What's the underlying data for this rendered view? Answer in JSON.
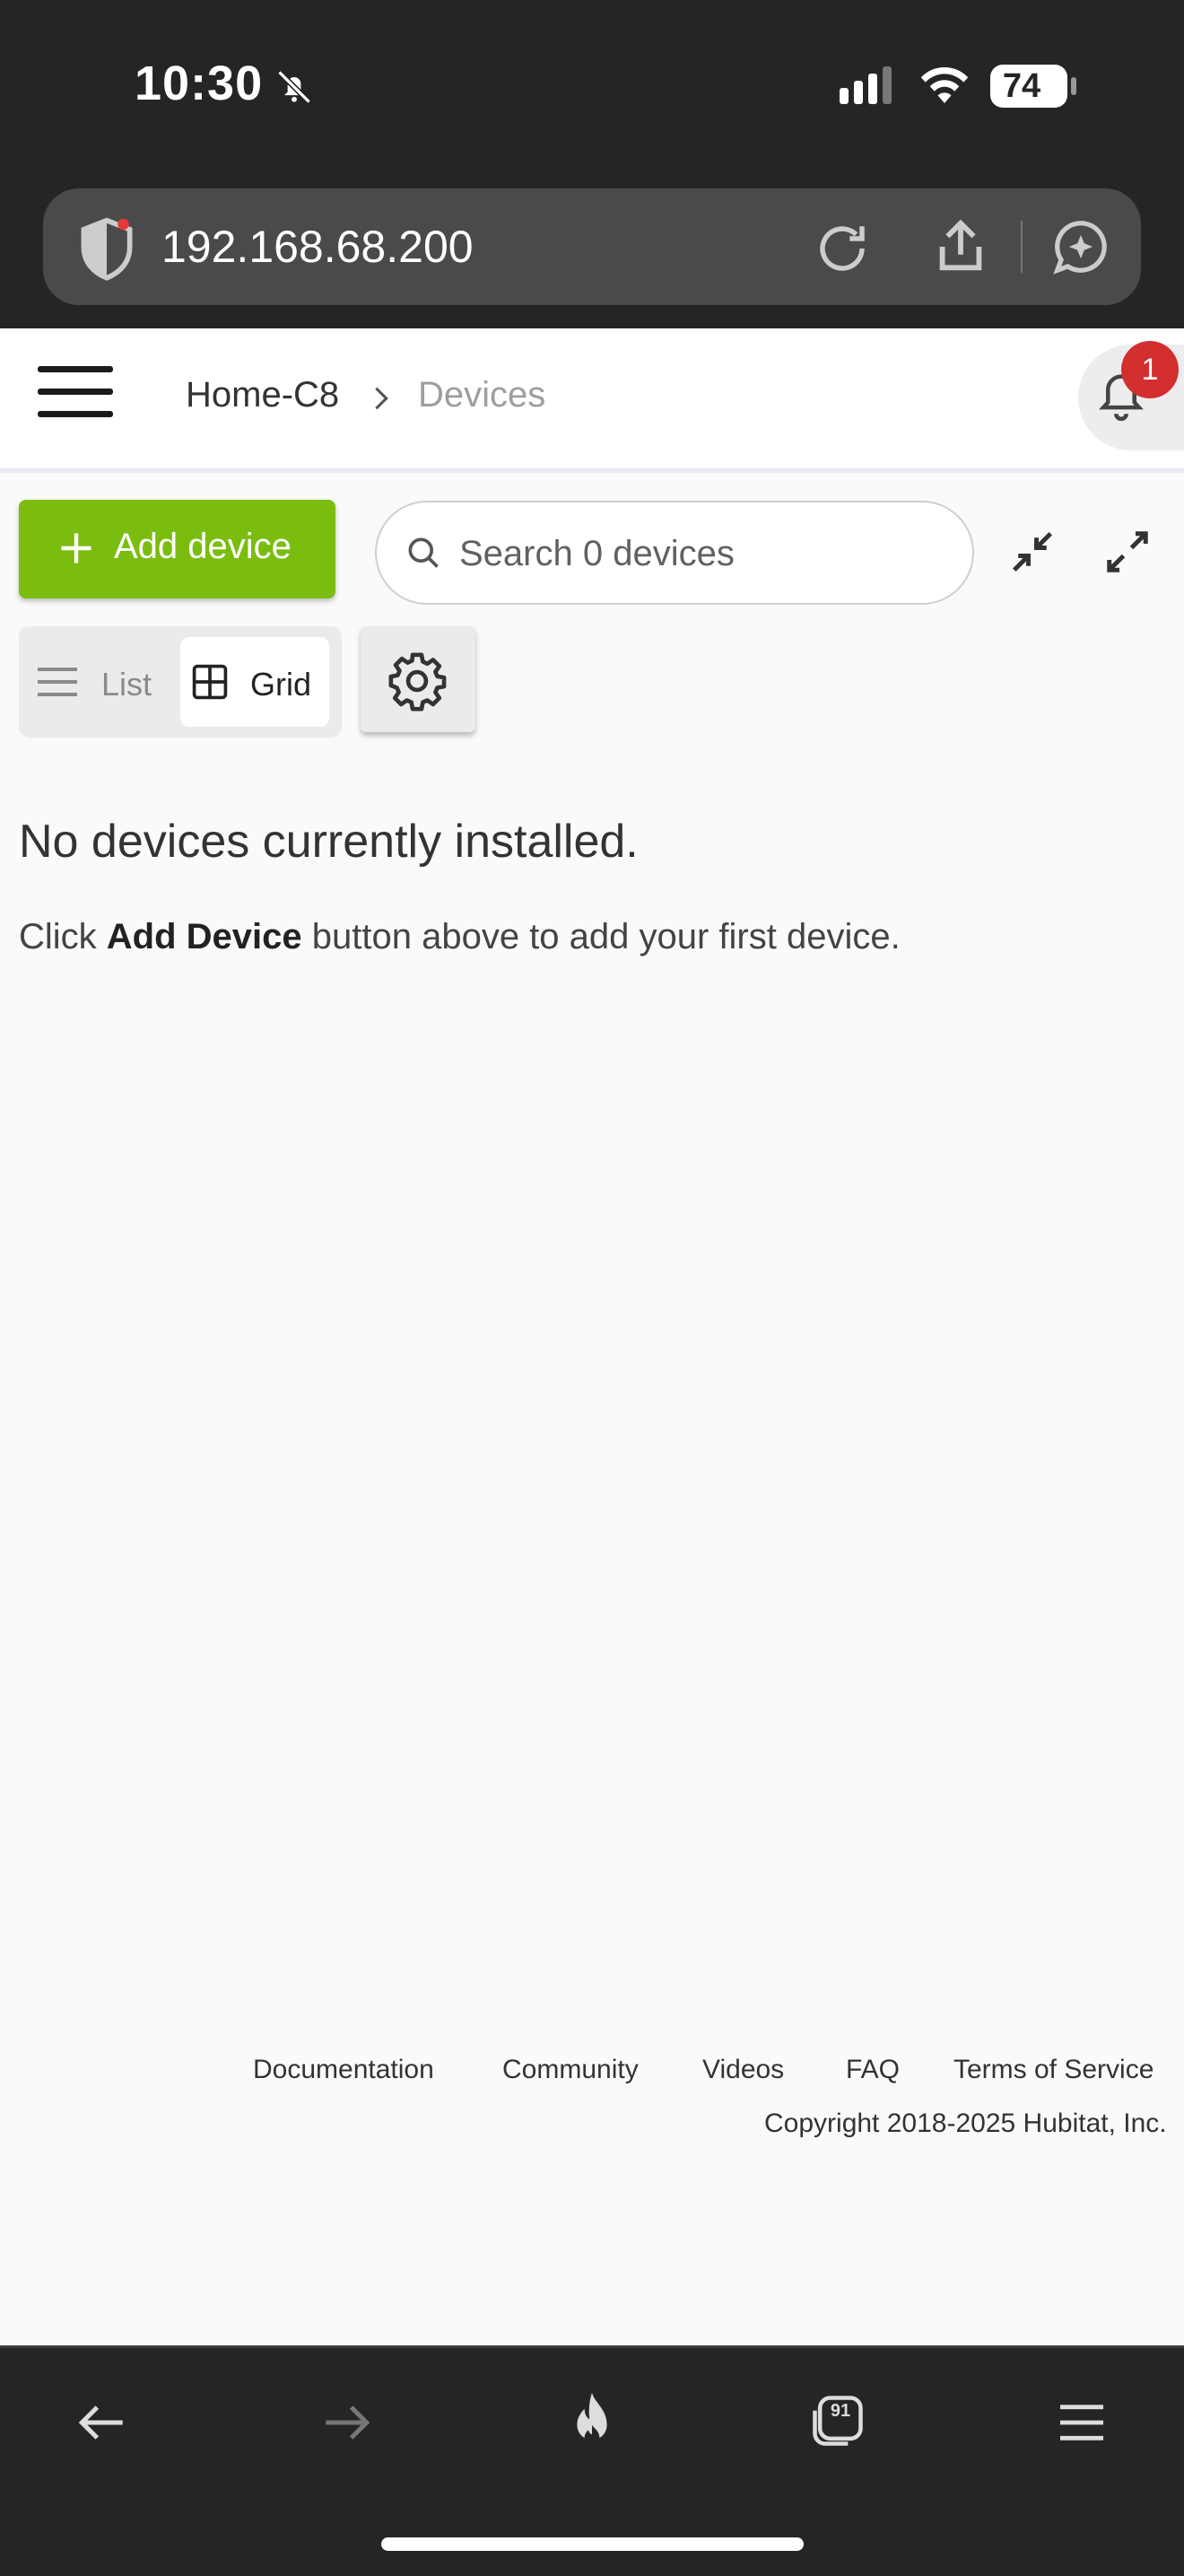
{
  "status_bar": {
    "time": "10:30",
    "battery": "74"
  },
  "browser": {
    "url": "192.168.68.200",
    "tab_count": "91"
  },
  "header": {
    "hub_name": "Home-C8",
    "current_page": "Devices",
    "notification_count": "1"
  },
  "toolbar": {
    "add_device_label": "Add device",
    "search_placeholder": "Search 0 devices",
    "view_list_label": "List",
    "view_grid_label": "Grid",
    "selected_view": "Grid"
  },
  "empty_state": {
    "title": "No devices currently installed.",
    "desc_prefix": "Click ",
    "desc_bold": "Add Device",
    "desc_suffix": " button above to add your first device."
  },
  "footer": {
    "links": [
      "Documentation",
      "Community",
      "Videos",
      "FAQ",
      "Terms of Service"
    ],
    "copyright": "Copyright 2018-2025 Hubitat, Inc."
  },
  "colors": {
    "accent": "#7bbd0e",
    "badge": "#d32f2f",
    "chrome": "#252525"
  }
}
